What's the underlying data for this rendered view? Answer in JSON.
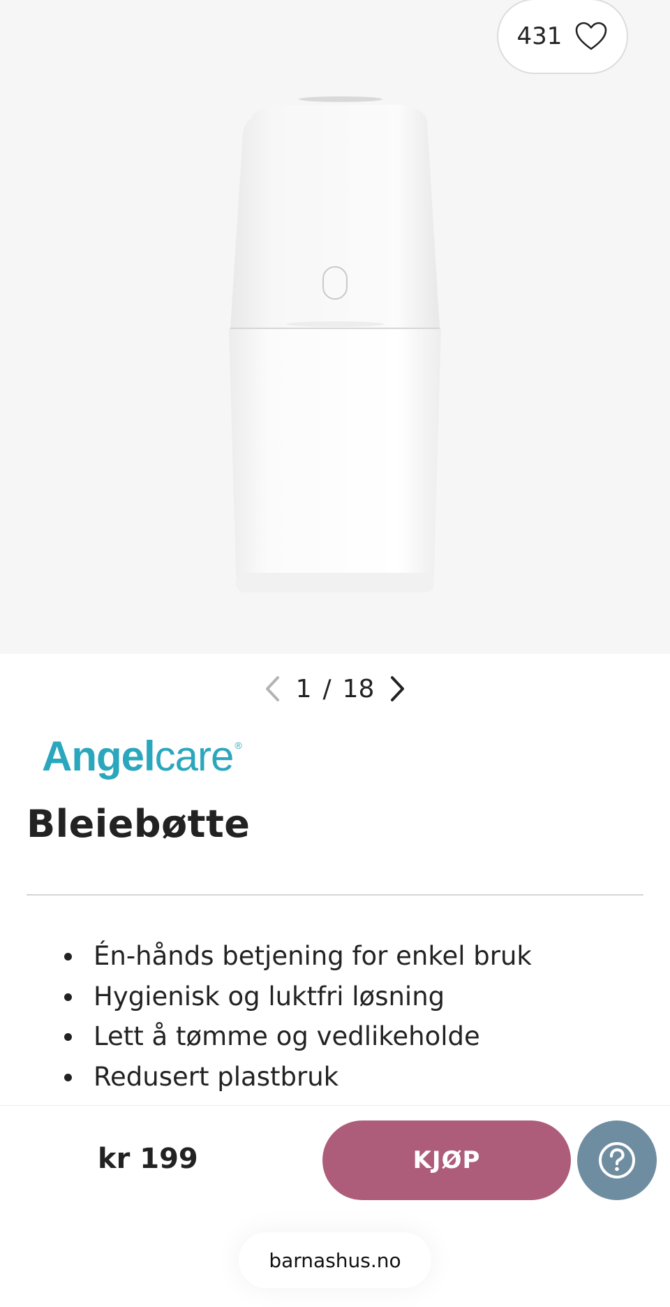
{
  "gallery": {
    "like_count": "431",
    "current": "1",
    "separator": "/",
    "total": "18"
  },
  "brand": {
    "logo_part1": "Angel",
    "logo_part2": "care",
    "logo_reg": "®"
  },
  "product": {
    "title": "Bleiebøtte",
    "features": [
      "Én-hånds betjening for enkel bruk",
      "Hygienisk og luktfri løsning",
      "Lett å tømme og vedlikeholde",
      "Redusert plastbruk"
    ]
  },
  "purchase": {
    "price": "kr 199",
    "buy_label": "KJØP"
  },
  "browser": {
    "domain": "barnashus.no"
  },
  "colors": {
    "buy_button": "#ad5d79",
    "help_button": "#6f8da0",
    "brand": "#2aa7bd"
  },
  "icons": [
    "heart-icon",
    "chevron-left-icon",
    "chevron-right-icon",
    "help-icon"
  ]
}
